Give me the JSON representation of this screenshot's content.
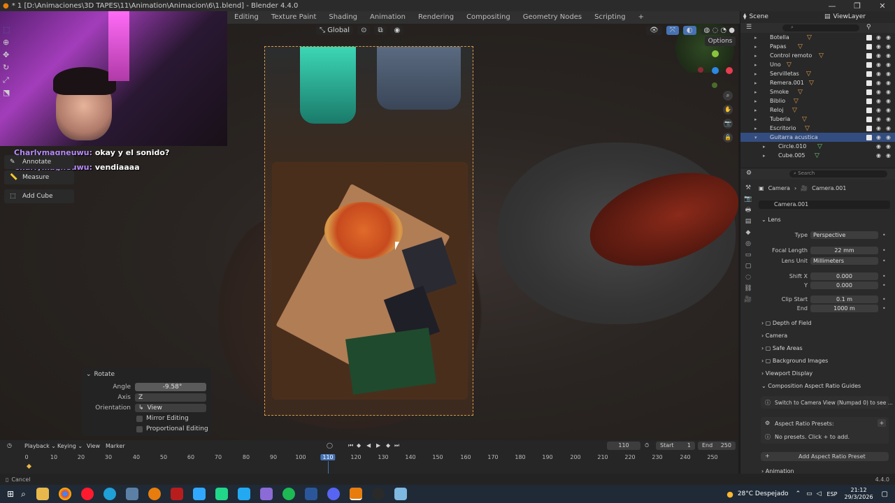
{
  "window": {
    "title": "* 1 [D:\\Animaciones\\3D TAPES\\11\\Animation\\Animacion\\6\\1.blend] - Blender 4.4.0"
  },
  "workspace_tabs": [
    "Editing",
    "Texture Paint",
    "Shading",
    "Animation",
    "Rendering",
    "Compositing",
    "Geometry Nodes",
    "Scripting"
  ],
  "viewport": {
    "transform_orientation": "Global",
    "options_label": "Options"
  },
  "chat": [
    {
      "user": "Charlymagneuwu:",
      "message": "okay y el sonido?"
    },
    {
      "user": "Charlymagneuwu:",
      "message": "vendiaaaa"
    }
  ],
  "tools": {
    "annotate": "Annotate",
    "measure": "Measure",
    "add_cube": "Add Cube"
  },
  "rotate_panel": {
    "title": "Rotate",
    "angle_label": "Angle",
    "angle_value": "-9.58°",
    "axis_label": "Axis",
    "axis_value": "Z",
    "orientation_label": "Orientation",
    "orientation_value": "View",
    "mirror_editing": "Mirror Editing",
    "proportional_editing": "Proportional Editing"
  },
  "outliner": {
    "scene": "Scene",
    "view_layer": "ViewLayer",
    "search_placeholder": "",
    "items": [
      {
        "name": "Botella"
      },
      {
        "name": "Papas"
      },
      {
        "name": "Control remoto"
      },
      {
        "name": "Uno"
      },
      {
        "name": "Servilletas"
      },
      {
        "name": "Remera.001"
      },
      {
        "name": "Smoke"
      },
      {
        "name": "Biblio"
      },
      {
        "name": "Reloj"
      },
      {
        "name": "Tuberia"
      },
      {
        "name": "Escritorio"
      },
      {
        "name": "Guitarra acustica"
      },
      {
        "name": "Circle.010"
      },
      {
        "name": "Cube.005"
      }
    ]
  },
  "properties": {
    "search_placeholder": "Search",
    "breadcrumb_object": "Camera",
    "breadcrumb_data": "Camera.001",
    "datablock": "Camera.001",
    "lens_section": "Lens",
    "type_label": "Type",
    "type_value": "Perspective",
    "focal_label": "Focal Length",
    "focal_value": "22 mm",
    "lens_unit_label": "Lens Unit",
    "lens_unit_value": "Millimeters",
    "shift_x_label": "Shift X",
    "shift_x_value": "0.000",
    "shift_y_label": "Y",
    "shift_y_value": "0.000",
    "clip_start_label": "Clip Start",
    "clip_start_value": "0.1 m",
    "clip_end_label": "End",
    "clip_end_value": "1000 m",
    "sections": [
      "Depth of Field",
      "Camera",
      "Safe Areas",
      "Background Images",
      "Viewport Display",
      "Composition Aspect Ratio Guides"
    ],
    "guide_hint": "Switch to Camera View (Numpad 0) to see ...",
    "presets_label": "Aspect Ratio Presets:",
    "no_presets": "No presets. Click + to add.",
    "add_preset": "Add Aspect Ratio Preset",
    "animation_section": "Animation"
  },
  "timeline": {
    "menus": [
      "Playback",
      "Keying",
      "View",
      "Marker"
    ],
    "current_frame": "110",
    "start_label": "Start",
    "start_value": "1",
    "end_label": "End",
    "end_value": "250",
    "ticks": [
      "0",
      "10",
      "20",
      "30",
      "40",
      "50",
      "60",
      "70",
      "80",
      "90",
      "100",
      "110",
      "120",
      "130",
      "140",
      "150",
      "160",
      "170",
      "180",
      "190",
      "200",
      "210",
      "220",
      "230",
      "240",
      "250"
    ],
    "playhead_frame": 110
  },
  "status": {
    "left": "Cancel",
    "version": "4.4.0"
  },
  "taskbar": {
    "weather": "28°C Despejado",
    "language": "ESP",
    "time": "21:12",
    "date": "29/3/2026"
  },
  "colors": {
    "accent": "#4772b3",
    "camera_frame": "#d99b4a",
    "playhead": "#4772b3"
  }
}
